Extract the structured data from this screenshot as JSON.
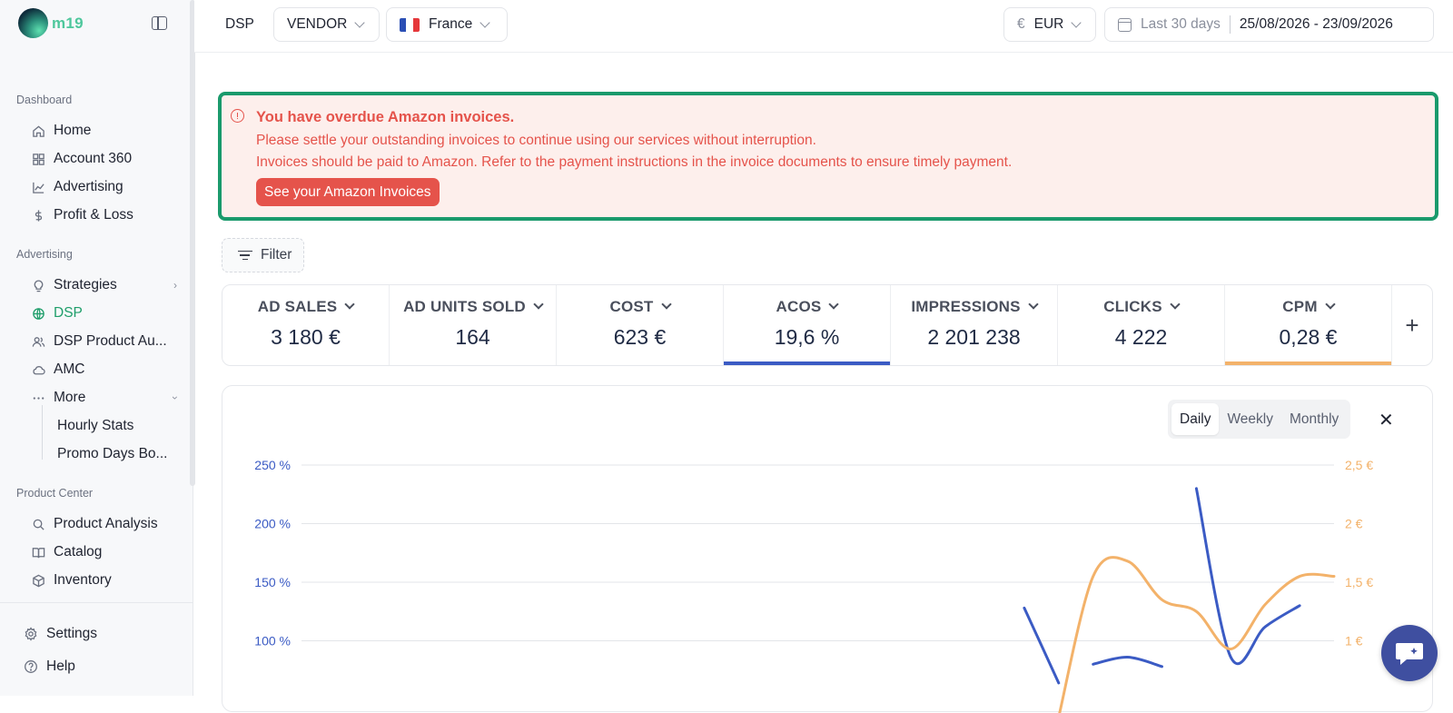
{
  "app": {
    "logo_text": "m19"
  },
  "sidebar": {
    "sections": {
      "dashboard": "Dashboard",
      "advertising": "Advertising",
      "product_center": "Product Center"
    },
    "dashboard_items": [
      "Home",
      "Account 360",
      "Advertising",
      "Profit & Loss"
    ],
    "advertising_items": [
      "Strategies",
      "DSP",
      "DSP Product Au...",
      "AMC",
      "More"
    ],
    "more_sub_items": [
      "Hourly Stats",
      "Promo Days Bo..."
    ],
    "product_items": [
      "Product Analysis",
      "Catalog",
      "Inventory"
    ],
    "bottom_items": [
      "Settings",
      "Help"
    ]
  },
  "topbar": {
    "section": "DSP",
    "account_type": "VENDOR",
    "marketplace": "France",
    "currency_symbol": "€",
    "currency": "EUR",
    "date_preset": "Last 30 days",
    "date_range": "25/08/2026 - 23/09/2026"
  },
  "alert": {
    "title": "You have overdue Amazon invoices.",
    "line1": "Please settle your outstanding invoices to continue using our services without interruption.",
    "line2": "Invoices should be paid to Amazon. Refer to the payment instructions in the invoice documents to ensure timely payment.",
    "button": "See your Amazon Invoices"
  },
  "filter": {
    "label": "Filter"
  },
  "metrics": [
    {
      "label": "AD SALES",
      "value": "3 180 €",
      "selected": false
    },
    {
      "label": "AD UNITS SOLD",
      "value": "164",
      "selected": false
    },
    {
      "label": "COST",
      "value": "623 €",
      "selected": false
    },
    {
      "label": "ACOS",
      "value": "19,6 %",
      "selected": true,
      "color": "#3b5bc4"
    },
    {
      "label": "IMPRESSIONS",
      "value": "2 201 238",
      "selected": false
    },
    {
      "label": "CLICKS",
      "value": "4 222",
      "selected": false
    },
    {
      "label": "CPM",
      "value": "0,28 €",
      "selected": true,
      "color": "#f3b26a"
    }
  ],
  "chart": {
    "periods": [
      "Daily",
      "Weekly",
      "Monthly"
    ],
    "active_period": "Daily"
  },
  "chart_data": {
    "type": "line",
    "left_axis": {
      "ticks": [
        "250 %",
        "200 %",
        "150 %",
        "100 %"
      ],
      "values": [
        250,
        200,
        150,
        100
      ],
      "color": "#3b5bc4"
    },
    "right_axis": {
      "ticks": [
        "2,5 €",
        "2 €",
        "1,5 €",
        "1 €"
      ],
      "values": [
        2.5,
        2.0,
        1.5,
        1.0
      ],
      "color": "#f3b26a"
    },
    "series": [
      {
        "axis": "left",
        "color": "#3b5bc4",
        "segments": [
          [
            [
              22,
              128
            ],
            [
              23,
              64
            ]
          ],
          [
            [
              24,
              80
            ],
            [
              25,
              86
            ],
            [
              26,
              78
            ]
          ],
          [
            [
              27,
              230
            ],
            [
              28,
              86
            ],
            [
              29,
              112
            ],
            [
              30,
              130
            ]
          ]
        ]
      },
      {
        "axis": "right",
        "color": "#f3b26a",
        "segments": [
          [
            [
              23,
              0.35
            ],
            [
              24,
              1.55
            ],
            [
              25,
              1.68
            ],
            [
              26,
              1.35
            ],
            [
              27,
              1.25
            ],
            [
              28,
              0.93
            ],
            [
              29,
              1.31
            ],
            [
              30,
              1.55
            ],
            [
              31,
              1.55
            ]
          ]
        ]
      }
    ],
    "grid": true
  },
  "colors": {
    "brand_green": "#1e9e6a",
    "alert_red": "#e5534b",
    "acos_blue": "#3b5bc4",
    "cpm_orange": "#f3b26a"
  },
  "icons": {
    "chat": "chat-bubble-icon",
    "close": "close-icon",
    "add": "plus-icon"
  }
}
